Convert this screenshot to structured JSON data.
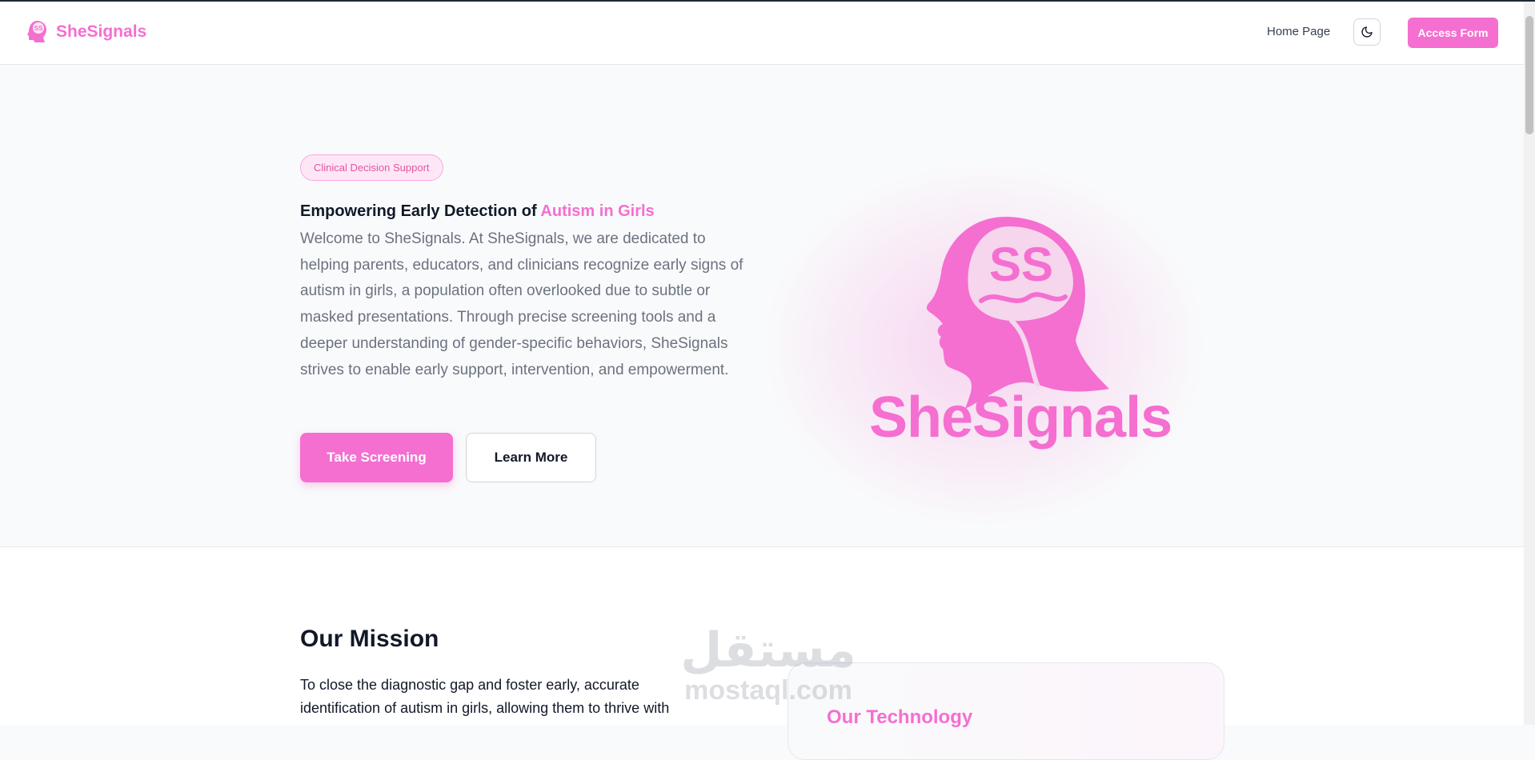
{
  "header": {
    "brand": "SheSignals",
    "nav": {
      "home": "Home Page"
    },
    "theme_toggle_icon": "moon-icon",
    "access_button": "Access Form"
  },
  "hero": {
    "badge": "Clinical Decision Support",
    "title_prefix": "Empowering Early Detection of ",
    "title_accent": "Autism in Girls",
    "body": "Welcome to SheSignals. At SheSignals, we are dedicated to helping parents, educators, and clinicians recognize early signs of autism in girls, a population often overlooked due to subtle or masked presentations. Through precise screening tools and a deeper understanding of gender-specific behaviors, SheSignals strives to enable early support, intervention, and empowerment.",
    "primary_button": "Take Screening",
    "secondary_button": "Learn More",
    "logo_text": "SheSignals",
    "logo_monogram": "SS"
  },
  "mission": {
    "title": "Our Mission",
    "text": "To close the diagnostic gap and foster early, accurate identification of autism in girls, allowing them to thrive with",
    "tech_card_title": "Our Technology"
  },
  "watermark": {
    "arabic": "مستقل",
    "latin": "mostaql.com"
  },
  "colors": {
    "accent": "#f46fd0",
    "text": "#111827",
    "muted": "#6b7280"
  }
}
